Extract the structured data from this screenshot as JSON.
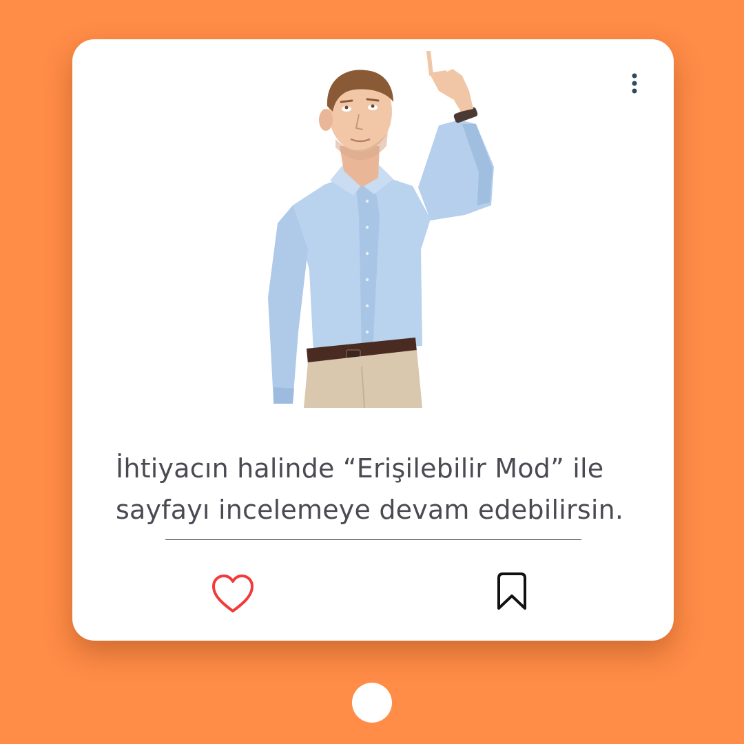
{
  "post": {
    "caption_line1": "İhtiyacın halinde “Erişilebilir Mod” ile",
    "caption_line2": "sayfayı incelemeye devam edebilirsin.",
    "image_alt": "Yukarıyı işaret eden adam",
    "icons": {
      "more": "more-vertical-icon",
      "like": "heart-icon",
      "save": "bookmark-icon"
    }
  },
  "colors": {
    "background": "#FF8C47",
    "card": "#FFFFFF",
    "text": "#4A4A52",
    "heart": "#F23A3A",
    "bookmark": "#111111",
    "more_dots": "#2F4A5E"
  },
  "carousel": {
    "current_page": 1,
    "total_pages": 1
  }
}
